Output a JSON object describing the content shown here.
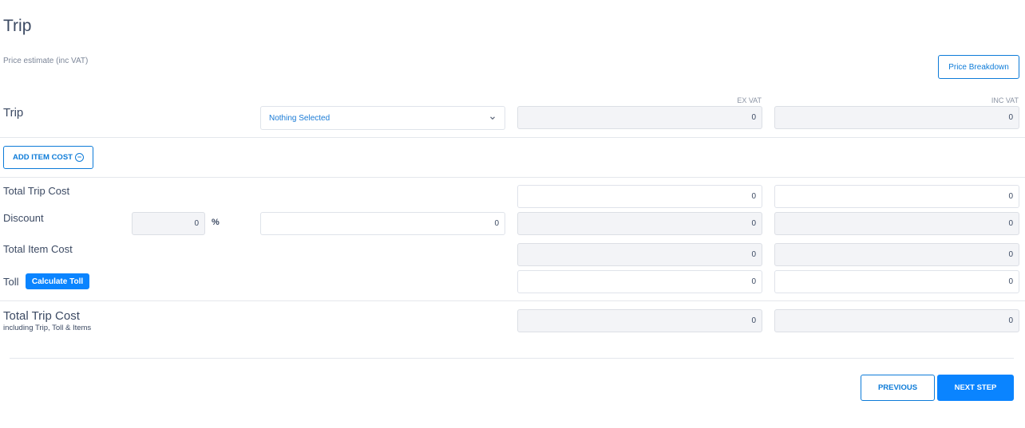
{
  "page": {
    "title": "Trip",
    "subtitle": "Price estimate (inc VAT)",
    "price_breakdown_label": "Price Breakdown"
  },
  "columns": {
    "ex_vat": "EX VAT",
    "inc_vat": "INC VAT"
  },
  "trip_row": {
    "label": "Trip",
    "select_value": "Nothing Selected",
    "ex_vat": "0",
    "inc_vat": "0"
  },
  "add_item": {
    "label": "ADD ITEM COST",
    "icon": "plus-circle-icon"
  },
  "total_trip_cost_row": {
    "label": "Total Trip Cost",
    "ex_vat": "0",
    "inc_vat": "0"
  },
  "discount_row": {
    "label": "Discount",
    "percent_value": "0",
    "percent_symbol": "%",
    "amount_value": "0",
    "ex_vat": "0",
    "inc_vat": "0"
  },
  "total_item_cost_row": {
    "label": "Total Item Cost",
    "ex_vat": "0",
    "inc_vat": "0"
  },
  "toll_row": {
    "label": "Toll",
    "calculate_label": "Calculate Toll",
    "ex_vat": "0",
    "inc_vat": "0"
  },
  "grand_total_row": {
    "label": "Total Trip Cost",
    "sublabel": "including Trip, Toll & Items",
    "ex_vat": "0",
    "inc_vat": "0"
  },
  "footer": {
    "previous_label": "PREVIOUS",
    "next_label": "NEXT STEP"
  },
  "colors": {
    "accent": "#0a84ff",
    "text": "#3c4a63",
    "readonly_bg": "#f3f4f7"
  }
}
